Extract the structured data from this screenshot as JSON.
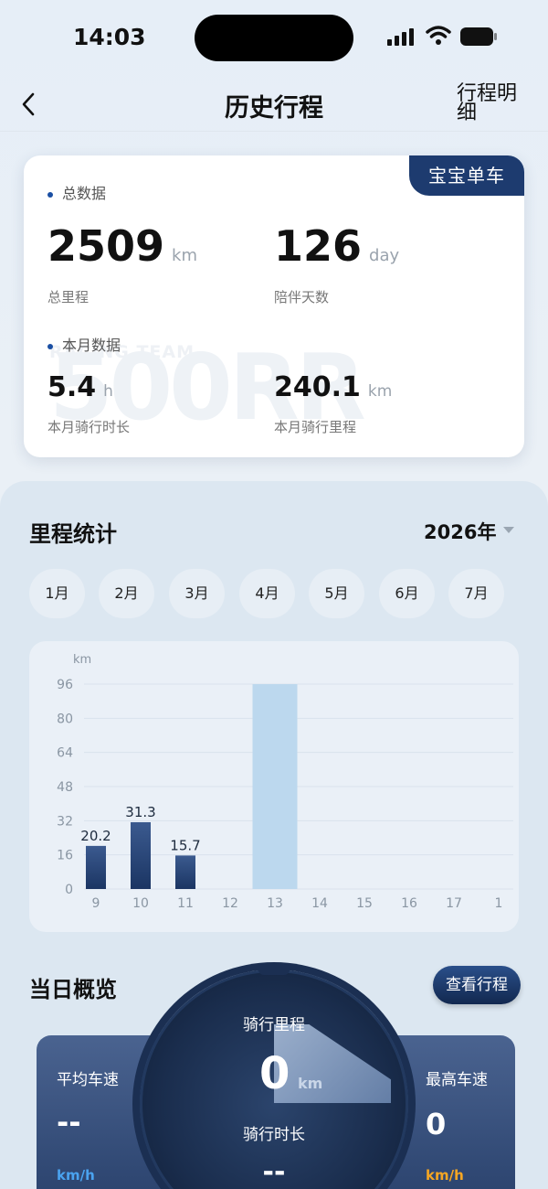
{
  "status": {
    "time": "14:03"
  },
  "nav": {
    "title": "历史行程",
    "right": "行程明细"
  },
  "summary": {
    "badge": "宝宝单车",
    "watermark_main": "500RR",
    "watermark_sub": "RACING TEAM",
    "total_header": "总数据",
    "total_mileage": {
      "value": "2509",
      "unit": "km",
      "label": "总里程"
    },
    "days": {
      "value": "126",
      "unit": "day",
      "label": "陪伴天数"
    },
    "month_header": "本月数据",
    "month_duration": {
      "value": "5.4",
      "unit": "h",
      "label": "本月骑行时长"
    },
    "month_mileage": {
      "value": "240.1",
      "unit": "km",
      "label": "本月骑行里程"
    }
  },
  "stats": {
    "title": "里程统计",
    "year": "2026年",
    "months": [
      "1月",
      "2月",
      "3月",
      "4月",
      "5月",
      "6月",
      "7月"
    ]
  },
  "chart_data": {
    "type": "bar",
    "ylabel": "km",
    "ylim": [
      0,
      96
    ],
    "yticks": [
      0,
      16,
      32,
      48,
      64,
      80,
      96
    ],
    "categories": [
      "9",
      "10",
      "11",
      "12",
      "13",
      "14",
      "15",
      "16",
      "17",
      "1"
    ],
    "values": [
      20.2,
      31.3,
      15.7,
      0,
      96,
      0,
      0,
      0,
      0,
      0
    ],
    "data_labels": [
      "20.2",
      "31.3",
      "15.7",
      "",
      "",
      "",
      "",
      "",
      "",
      ""
    ],
    "colors": {
      "normal": "#1b3563",
      "normal_top": "#3b5a8f",
      "selected": "#bcd8ee",
      "grid": "#d9e2ec"
    },
    "selected_index": 4,
    "grid": true
  },
  "overview": {
    "title": "当日概览",
    "button": "查看行程",
    "avg_speed": {
      "label": "平均车速",
      "value": "--",
      "unit": "km/h"
    },
    "max_speed": {
      "label": "最高车速",
      "value": "0",
      "unit": "km/h"
    },
    "ride_mileage": {
      "label": "骑行里程",
      "value": "0",
      "unit": "km"
    },
    "ride_duration": {
      "label": "骑行时长",
      "value": "--"
    }
  }
}
